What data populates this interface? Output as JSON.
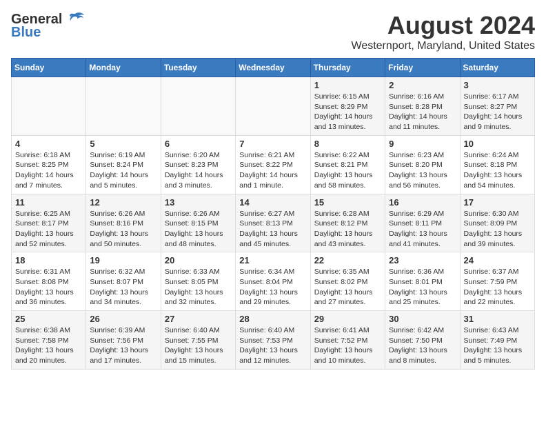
{
  "logo": {
    "general": "General",
    "blue": "Blue"
  },
  "title": "August 2024",
  "location": "Westernport, Maryland, United States",
  "weekdays": [
    "Sunday",
    "Monday",
    "Tuesday",
    "Wednesday",
    "Thursday",
    "Friday",
    "Saturday"
  ],
  "weeks": [
    [
      {
        "day": "",
        "info": ""
      },
      {
        "day": "",
        "info": ""
      },
      {
        "day": "",
        "info": ""
      },
      {
        "day": "",
        "info": ""
      },
      {
        "day": "1",
        "info": "Sunrise: 6:15 AM\nSunset: 8:29 PM\nDaylight: 14 hours\nand 13 minutes."
      },
      {
        "day": "2",
        "info": "Sunrise: 6:16 AM\nSunset: 8:28 PM\nDaylight: 14 hours\nand 11 minutes."
      },
      {
        "day": "3",
        "info": "Sunrise: 6:17 AM\nSunset: 8:27 PM\nDaylight: 14 hours\nand 9 minutes."
      }
    ],
    [
      {
        "day": "4",
        "info": "Sunrise: 6:18 AM\nSunset: 8:25 PM\nDaylight: 14 hours\nand 7 minutes."
      },
      {
        "day": "5",
        "info": "Sunrise: 6:19 AM\nSunset: 8:24 PM\nDaylight: 14 hours\nand 5 minutes."
      },
      {
        "day": "6",
        "info": "Sunrise: 6:20 AM\nSunset: 8:23 PM\nDaylight: 14 hours\nand 3 minutes."
      },
      {
        "day": "7",
        "info": "Sunrise: 6:21 AM\nSunset: 8:22 PM\nDaylight: 14 hours\nand 1 minute."
      },
      {
        "day": "8",
        "info": "Sunrise: 6:22 AM\nSunset: 8:21 PM\nDaylight: 13 hours\nand 58 minutes."
      },
      {
        "day": "9",
        "info": "Sunrise: 6:23 AM\nSunset: 8:20 PM\nDaylight: 13 hours\nand 56 minutes."
      },
      {
        "day": "10",
        "info": "Sunrise: 6:24 AM\nSunset: 8:18 PM\nDaylight: 13 hours\nand 54 minutes."
      }
    ],
    [
      {
        "day": "11",
        "info": "Sunrise: 6:25 AM\nSunset: 8:17 PM\nDaylight: 13 hours\nand 52 minutes."
      },
      {
        "day": "12",
        "info": "Sunrise: 6:26 AM\nSunset: 8:16 PM\nDaylight: 13 hours\nand 50 minutes."
      },
      {
        "day": "13",
        "info": "Sunrise: 6:26 AM\nSunset: 8:15 PM\nDaylight: 13 hours\nand 48 minutes."
      },
      {
        "day": "14",
        "info": "Sunrise: 6:27 AM\nSunset: 8:13 PM\nDaylight: 13 hours\nand 45 minutes."
      },
      {
        "day": "15",
        "info": "Sunrise: 6:28 AM\nSunset: 8:12 PM\nDaylight: 13 hours\nand 43 minutes."
      },
      {
        "day": "16",
        "info": "Sunrise: 6:29 AM\nSunset: 8:11 PM\nDaylight: 13 hours\nand 41 minutes."
      },
      {
        "day": "17",
        "info": "Sunrise: 6:30 AM\nSunset: 8:09 PM\nDaylight: 13 hours\nand 39 minutes."
      }
    ],
    [
      {
        "day": "18",
        "info": "Sunrise: 6:31 AM\nSunset: 8:08 PM\nDaylight: 13 hours\nand 36 minutes."
      },
      {
        "day": "19",
        "info": "Sunrise: 6:32 AM\nSunset: 8:07 PM\nDaylight: 13 hours\nand 34 minutes."
      },
      {
        "day": "20",
        "info": "Sunrise: 6:33 AM\nSunset: 8:05 PM\nDaylight: 13 hours\nand 32 minutes."
      },
      {
        "day": "21",
        "info": "Sunrise: 6:34 AM\nSunset: 8:04 PM\nDaylight: 13 hours\nand 29 minutes."
      },
      {
        "day": "22",
        "info": "Sunrise: 6:35 AM\nSunset: 8:02 PM\nDaylight: 13 hours\nand 27 minutes."
      },
      {
        "day": "23",
        "info": "Sunrise: 6:36 AM\nSunset: 8:01 PM\nDaylight: 13 hours\nand 25 minutes."
      },
      {
        "day": "24",
        "info": "Sunrise: 6:37 AM\nSunset: 7:59 PM\nDaylight: 13 hours\nand 22 minutes."
      }
    ],
    [
      {
        "day": "25",
        "info": "Sunrise: 6:38 AM\nSunset: 7:58 PM\nDaylight: 13 hours\nand 20 minutes."
      },
      {
        "day": "26",
        "info": "Sunrise: 6:39 AM\nSunset: 7:56 PM\nDaylight: 13 hours\nand 17 minutes."
      },
      {
        "day": "27",
        "info": "Sunrise: 6:40 AM\nSunset: 7:55 PM\nDaylight: 13 hours\nand 15 minutes."
      },
      {
        "day": "28",
        "info": "Sunrise: 6:40 AM\nSunset: 7:53 PM\nDaylight: 13 hours\nand 12 minutes."
      },
      {
        "day": "29",
        "info": "Sunrise: 6:41 AM\nSunset: 7:52 PM\nDaylight: 13 hours\nand 10 minutes."
      },
      {
        "day": "30",
        "info": "Sunrise: 6:42 AM\nSunset: 7:50 PM\nDaylight: 13 hours\nand 8 minutes."
      },
      {
        "day": "31",
        "info": "Sunrise: 6:43 AM\nSunset: 7:49 PM\nDaylight: 13 hours\nand 5 minutes."
      }
    ]
  ]
}
